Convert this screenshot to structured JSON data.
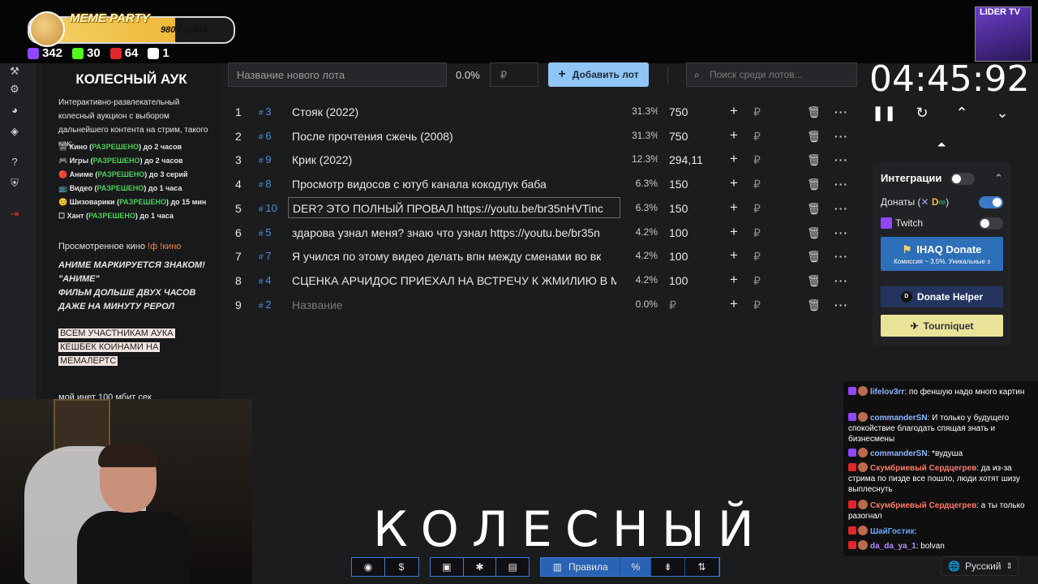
{
  "overlay": {
    "meme_title": "MEME PARTY",
    "meme_count": "980 / 11488",
    "meme_progress": 0.085,
    "stats": [
      {
        "icon": "twitch-icon",
        "value": "342",
        "color": "#9146ff"
      },
      {
        "icon": "kick-icon",
        "value": "30",
        "color": "#53fc18"
      },
      {
        "icon": "live-icon",
        "value": "64",
        "color": "#e0262a"
      },
      {
        "icon": "w-icon",
        "value": "1",
        "color": "#ffffff"
      }
    ],
    "channel_badge": "LIDER TV"
  },
  "description": {
    "title": "КОЛЕСНЫЙ АУК",
    "intro": "Интерактивно-развлекательный колесный аукцион с выбором дальнейшего контента на стрим, такого как:",
    "rules": [
      {
        "emoji": "🎬",
        "name": "Кино",
        "status": "РАЗРЕШЕНО",
        "limit": "до 2 часов"
      },
      {
        "emoji": "🎮",
        "name": "Игры",
        "status": "РАЗРЕШЕНО",
        "limit": "до 2 часов"
      },
      {
        "emoji": "🔴",
        "name": "Аниме",
        "status": "РАЗРЕШЕНО",
        "limit": "до 3 серий"
      },
      {
        "emoji": "📺",
        "name": "Видео",
        "status": "РАЗРЕШЕНО",
        "limit": "до 1 часа"
      },
      {
        "emoji": "😊",
        "name": "Шизоварики",
        "status": "РАЗРЕШЕНО",
        "limit": "до 15 мин"
      },
      {
        "emoji": "☐",
        "name": "Хант",
        "status": "РАЗРЕШЕНО",
        "limit": "до 1 часа"
      }
    ],
    "watched_label": "Просмотренное кино",
    "watched_cmd": "!ф !кино",
    "anime_note": "АНИМЕ МАРКИРУЕТСЯ ЗНАКОМ! \"АНИМЕ\"",
    "film_note": "ФИЛЬМ ДОЛЬШЕ ДВУХ ЧАСОВ ДАЖЕ НА МИНУТУ РЕРОЛ",
    "cashback_lines": [
      "ВСЕМ УЧАСТНИКАМ АУКА",
      "КЕШБЕК КОИНАМИ НА",
      "МЕМАЛЕРТС"
    ],
    "internet": "мой инет 100 мбит сек"
  },
  "toolbar": {
    "lot_placeholder": "Название нового лота",
    "percent": "0.0%",
    "currency": "₽",
    "add_label": "Добавить лот",
    "search_placeholder": "Поиск среди лотов..."
  },
  "lots": [
    {
      "n": "1",
      "id": "3",
      "name": "Стояк (2022)",
      "percent": "31.3%",
      "amount": "750"
    },
    {
      "n": "2",
      "id": "6",
      "name": "После прочтения сжечь (2008)",
      "percent": "31.3%",
      "amount": "750"
    },
    {
      "n": "3",
      "id": "9",
      "name": "Крик (2022)",
      "percent": "12.3%",
      "amount": "294,11"
    },
    {
      "n": "4",
      "id": "8",
      "name": "Просмотр видосов с ютуб канала кокодлук баба",
      "percent": "6.3%",
      "amount": "150"
    },
    {
      "n": "5",
      "id": "10",
      "name": "DER? ЭТО ПОЛНЫЙ ПРОВАЛ https://youtu.be/br35nHVTinc",
      "percent": "6.3%",
      "amount": "150",
      "editing": true
    },
    {
      "n": "6",
      "id": "5",
      "name": "здарова узнал меня? знаю что узнал https://youtu.be/br35n",
      "percent": "4.2%",
      "amount": "100"
    },
    {
      "n": "7",
      "id": "7",
      "name": "Я учился по этому видео делать впн между сменами во вк",
      "percent": "4.2%",
      "amount": "100"
    },
    {
      "n": "8",
      "id": "4",
      "name": "СЦЕНКА АРЧИДОС ПРИЕХАЛ НА ВСТРЕЧУ К ЖМИЛИЮ В М",
      "percent": "4.2%",
      "amount": "100"
    },
    {
      "n": "9",
      "id": "2",
      "name": "Название",
      "percent": "0.0%",
      "amount": "₽",
      "placeholder": true
    }
  ],
  "timer": {
    "value": "04:45:92"
  },
  "integrations": {
    "title": "Интеграции",
    "donations_label": "Донаты (",
    "donations_label_end": ")",
    "twitch_label": "Twitch",
    "ihaq_label": "IHAQ Donate",
    "ihaq_sub": "Комиссия ~ 3,5%. Уникальные з",
    "donate_helper": "Donate Helper",
    "tourniquet": "Tourniquet"
  },
  "chat": [
    {
      "user": "lifelov3rr",
      "color": "#8fb7ff",
      "text": "по феншую надо много картин"
    },
    {
      "user": "commanderSN",
      "color": "#8fb7ff",
      "text": "И только у будущего спокойствие благодать спящая знать и бизнесмены"
    },
    {
      "user": "commanderSN",
      "color": "#8fb7ff",
      "text": "*вудуша"
    },
    {
      "user": "Скумбриевый Сердцегрев",
      "color": "#ff7a6b",
      "text": "да из-за стрима по пизде все пошло, люди хотят шизу выплеснуть"
    },
    {
      "user": "Скумбриевый Сердцегрев",
      "color": "#ff7a6b",
      "text": "а ты только разогнал"
    },
    {
      "user": "ШайГостик",
      "color": "#6aa6ff",
      "text": ""
    },
    {
      "user": "da_da_ya_1",
      "color": "#b58cff",
      "text": "bolvan"
    }
  ],
  "language": "Русский",
  "stage_title": "КОЛЕСНЫЙ",
  "bottom_toolbar": {
    "rules_label": "Правила"
  }
}
